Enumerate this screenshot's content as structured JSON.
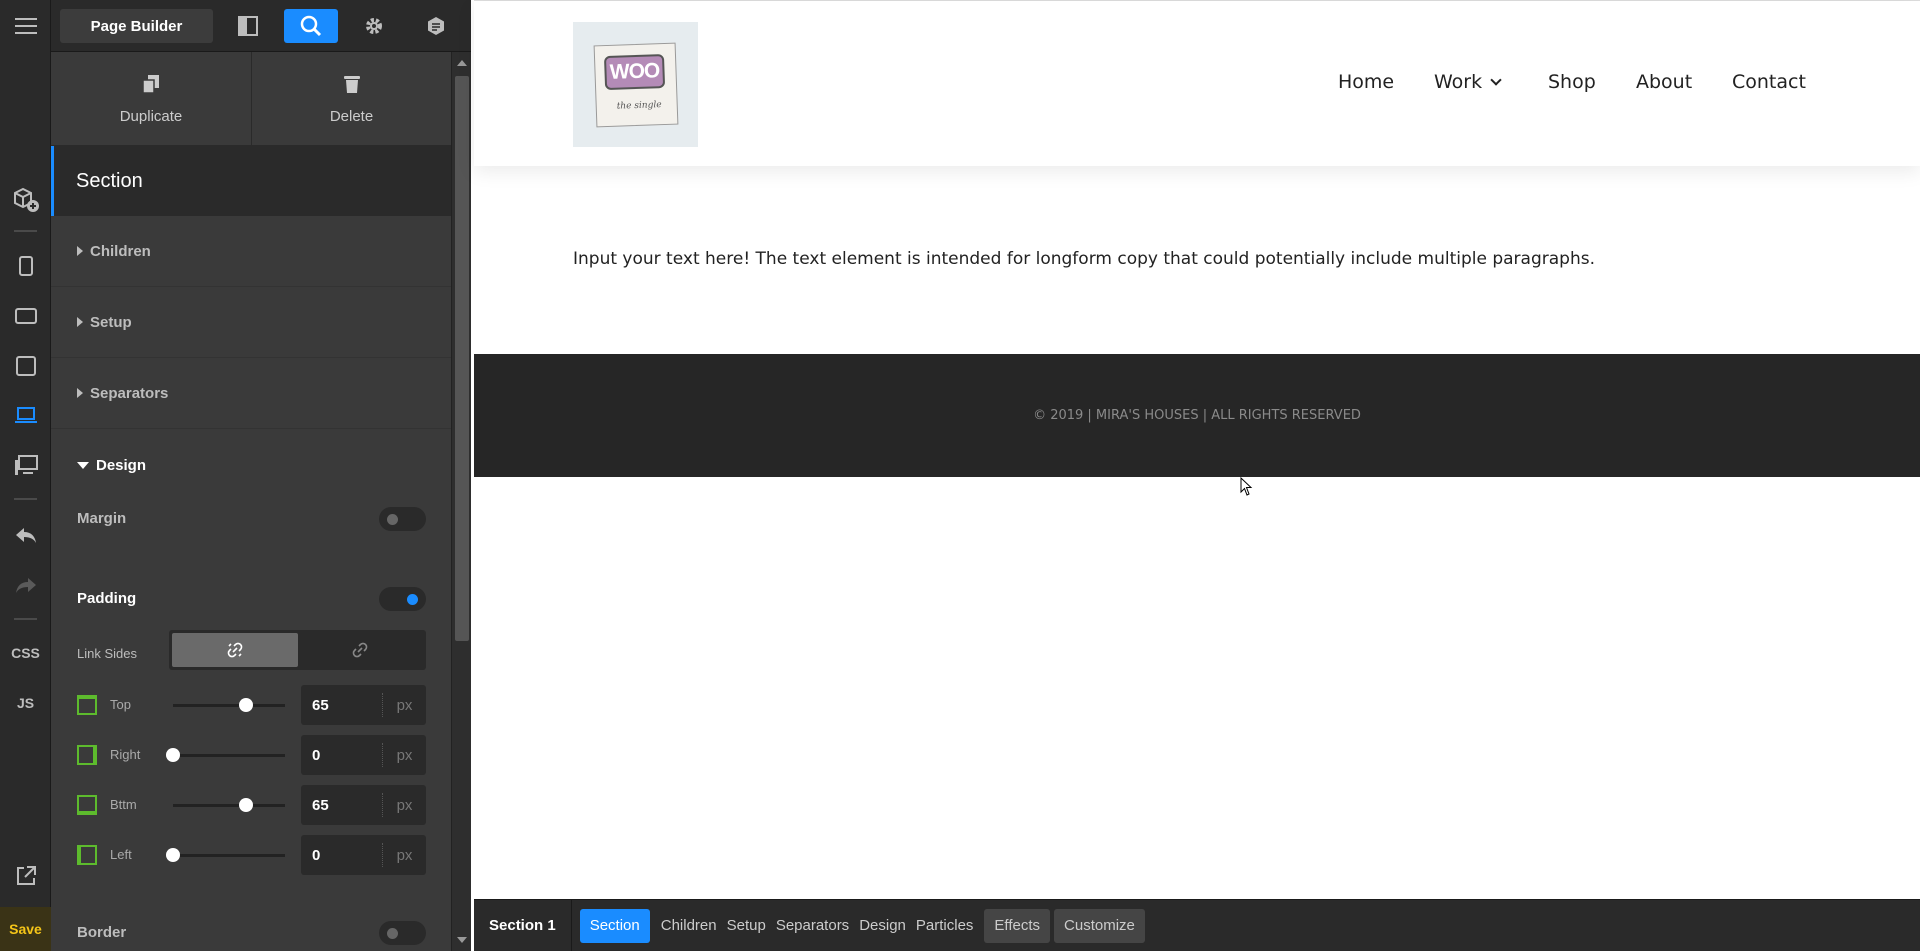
{
  "sidebar_rail": {
    "css_label": "CSS",
    "js_label": "JS",
    "save_label": "Save"
  },
  "topbar": {
    "page_builder_label": "Page Builder"
  },
  "panel": {
    "duplicate_label": "Duplicate",
    "delete_label": "Delete",
    "section_title": "Section",
    "groups": {
      "children": "Children",
      "setup": "Setup",
      "separators": "Separators",
      "design": "Design"
    },
    "margin_label": "Margin",
    "padding_label": "Padding",
    "link_sides_label": "Link Sides",
    "border_label": "Border",
    "padding_rows": [
      {
        "label": "Top",
        "value": "65",
        "unit": "px"
      },
      {
        "label": "Right",
        "value": "0",
        "unit": "px"
      },
      {
        "label": "Bttm",
        "value": "65",
        "unit": "px"
      },
      {
        "label": "Left",
        "value": "0",
        "unit": "px"
      }
    ],
    "margin_enabled": false,
    "padding_enabled": true,
    "border_enabled": false
  },
  "preview": {
    "logo_text": "WOO",
    "logo_tagline": "the single",
    "nav": [
      "Home",
      "Work",
      "Shop",
      "About",
      "Contact"
    ],
    "content_text": "Input your text here! The text element is intended for longform copy that could potentially include multiple paragraphs.",
    "footer_text": "© 2019 | MIRA'S HOUSES | ALL RIGHTS RESERVED"
  },
  "breadcrumb": {
    "root": "Section 1",
    "active": "Section",
    "tabs": [
      "Children",
      "Setup",
      "Separators",
      "Design",
      "Particles"
    ],
    "boxed": [
      "Effects",
      "Customize"
    ]
  },
  "colors": {
    "accent": "#1a8cff",
    "save": "#f5c518",
    "side_icon": "#5dbb2d"
  }
}
